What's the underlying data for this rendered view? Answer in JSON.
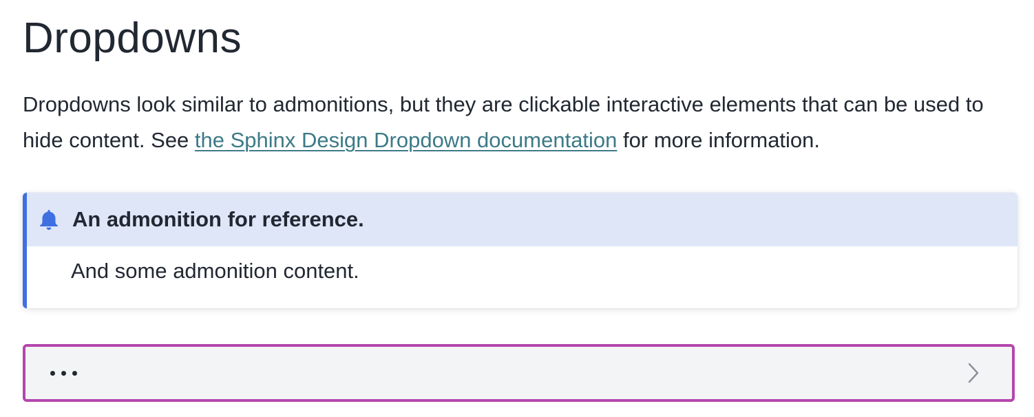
{
  "page": {
    "heading": "Dropdowns",
    "intro_before_link": "Dropdowns look similar to admonitions, but they are clickable interactive elements that can be used to hide content. See ",
    "intro_link_text": "the Sphinx Design Dropdown documentation",
    "intro_after_link": " for more information."
  },
  "admonition": {
    "icon": "bell-icon",
    "title": "An admonition for reference.",
    "body": "And some admonition content.",
    "accent_color": "#3f6fe0",
    "title_bg_color": "#dfe6f8"
  },
  "dropdown": {
    "icon_left": "ellipsis-icon",
    "icon_right": "chevron-right-icon",
    "border_color": "#b546ad",
    "bg_color": "#f3f4f6"
  },
  "colors": {
    "text": "#222832",
    "link": "#3c7a87"
  }
}
